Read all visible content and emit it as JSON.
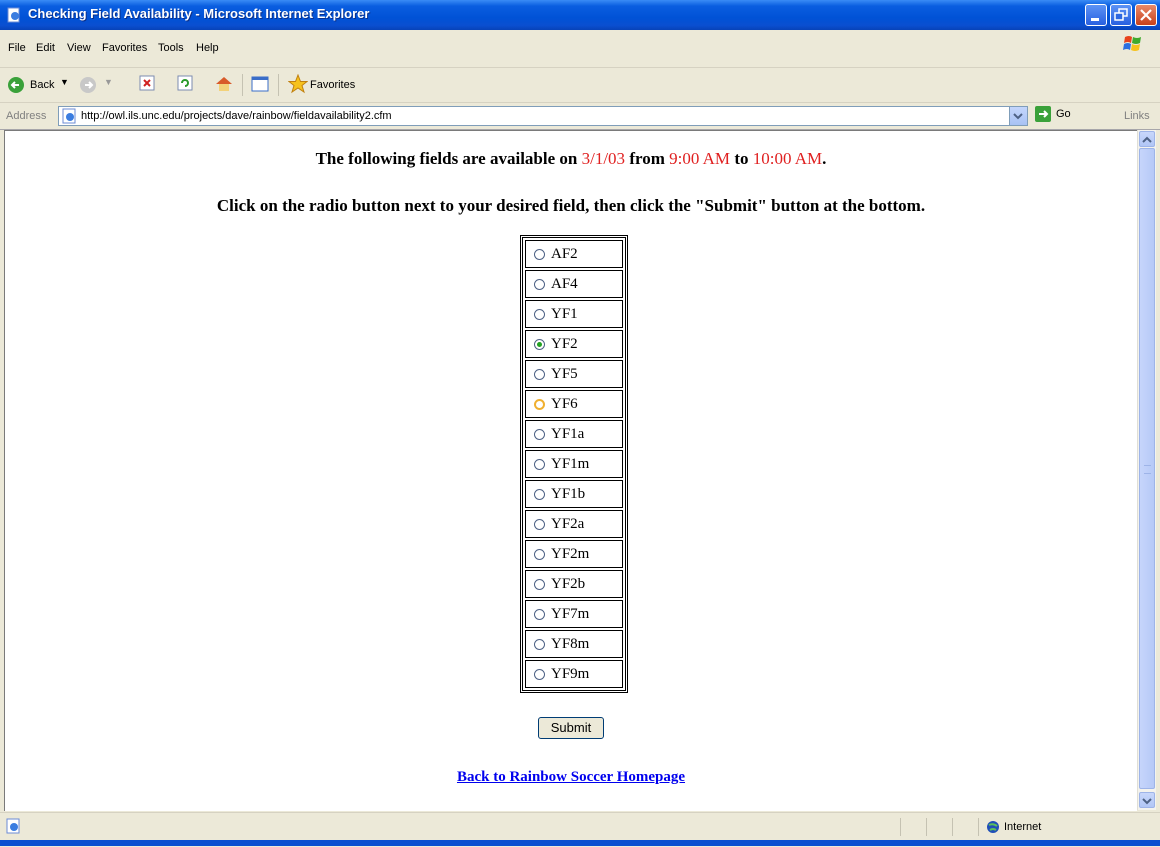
{
  "window": {
    "title": "Checking Field Availability - Microsoft Internet Explorer"
  },
  "menu": {
    "items": [
      "File",
      "Edit",
      "View",
      "Favorites",
      "Tools",
      "Help"
    ]
  },
  "toolbar": {
    "back_label": "Back",
    "favorites_label": "Favorites"
  },
  "address": {
    "label": "Address",
    "url": "http://owl.ils.unc.edu/projects/dave/rainbow/fieldavailability2.cfm",
    "go_label": "Go",
    "links_label": "Links"
  },
  "page": {
    "intro_prefix": "The following fields are available on ",
    "date": "3/1/03",
    "from_word": " from ",
    "start_time": "9:00 AM",
    "to_word": " to ",
    "end_time": "10:00 AM",
    "period": ".",
    "instruction": "Click on the radio button next to your desired field, then click the \"Submit\" button at the bottom.",
    "fields": [
      "AF2",
      "AF4",
      "YF1",
      "YF2",
      "YF5",
      "YF6",
      "YF1a",
      "YF1m",
      "YF1b",
      "YF2a",
      "YF2m",
      "YF2b",
      "YF7m",
      "YF8m",
      "YF9m"
    ],
    "selected_field": "YF2",
    "hover_field": "YF6",
    "submit_label": "Submit",
    "back_link": "Back to Rainbow Soccer Homepage"
  },
  "status": {
    "zone": "Internet"
  },
  "colors": {
    "highlight_red": "#e02020",
    "link_blue": "#0000ee",
    "titlebar_blue": "#0a5ee0"
  }
}
